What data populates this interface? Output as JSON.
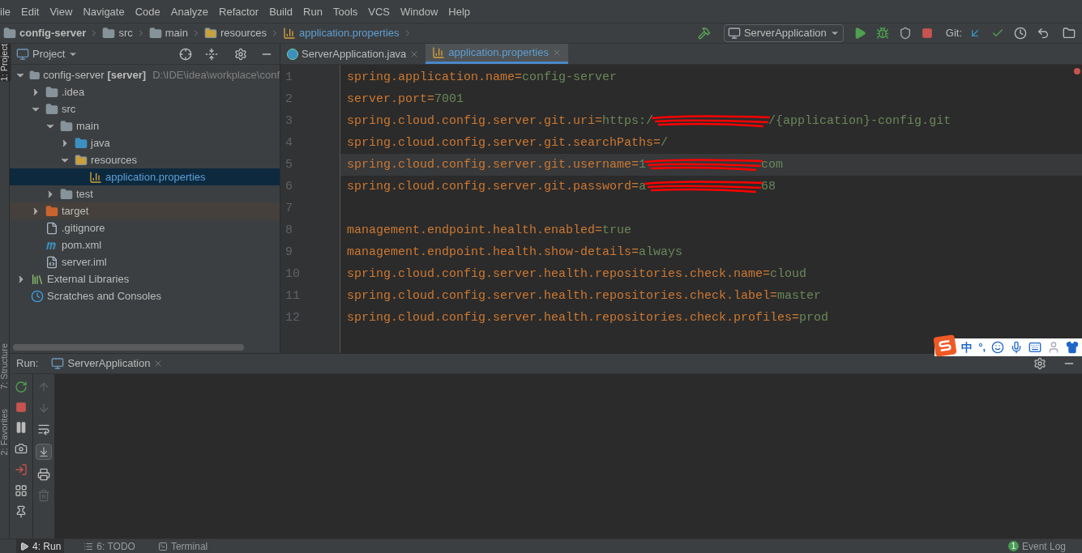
{
  "menu": [
    "ile",
    "Edit",
    "View",
    "Navigate",
    "Code",
    "Analyze",
    "Refactor",
    "Build",
    "Run",
    "Tools",
    "VCS",
    "Window",
    "Help"
  ],
  "breadcrumbs": [
    {
      "label": "config-server",
      "kind": "module"
    },
    {
      "label": "src",
      "kind": "folder"
    },
    {
      "label": "main",
      "kind": "folder"
    },
    {
      "label": "resources",
      "kind": "resources-folder"
    },
    {
      "label": "application.properties",
      "kind": "properties"
    }
  ],
  "run_config": "ServerApplication",
  "vcs_label": "Git:",
  "side_strip": [
    {
      "label": "1: Project",
      "selected": true
    },
    {
      "label": "7: Structure",
      "selected": false
    },
    {
      "label": "2: Favorites",
      "selected": false
    }
  ],
  "project_panel": {
    "title": "Project"
  },
  "tree": [
    {
      "name": "config-server",
      "module": "[server]",
      "path": "D:\\IDE\\idea\\workplace\\conf",
      "kind": "module",
      "expanded": true,
      "selected": false,
      "children": [
        {
          "name": ".idea",
          "kind": "folder",
          "expanded": false,
          "selected": false
        },
        {
          "name": "src",
          "kind": "folder",
          "expanded": true,
          "selected": false,
          "children": [
            {
              "name": "main",
              "kind": "folder",
              "expanded": true,
              "selected": false,
              "children": [
                {
                  "name": "java",
                  "kind": "source-folder",
                  "expanded": false,
                  "selected": false
                },
                {
                  "name": "resources",
                  "kind": "resources-folder",
                  "expanded": true,
                  "selected": false,
                  "children": [
                    {
                      "name": "application.properties",
                      "kind": "properties",
                      "selected": true
                    }
                  ]
                }
              ]
            },
            {
              "name": "test",
              "kind": "folder",
              "expanded": false,
              "selected": false
            }
          ]
        },
        {
          "name": "target",
          "kind": "excluded-folder",
          "expanded": false,
          "selected": false
        },
        {
          "name": ".gitignore",
          "kind": "file",
          "selected": false
        },
        {
          "name": "pom.xml",
          "kind": "maven",
          "selected": false
        },
        {
          "name": "server.iml",
          "kind": "iml",
          "selected": false
        }
      ]
    },
    {
      "name": "External Libraries",
      "kind": "libraries",
      "expanded": false,
      "selected": false
    },
    {
      "name": "Scratches and Consoles",
      "kind": "scratches",
      "selected": false
    }
  ],
  "editor_tabs": [
    {
      "label": "ServerApplication.java",
      "kind": "java",
      "selected": false
    },
    {
      "label": "application.properties",
      "kind": "properties",
      "selected": true
    }
  ],
  "lines": [
    {
      "number": "1",
      "key": "spring.application.name",
      "eq": "=",
      "value": "config-server",
      "current": false
    },
    {
      "number": "2",
      "key": "server.port",
      "eq": "=",
      "value": "7001",
      "current": false
    },
    {
      "number": "3",
      "key": "spring.cloud.config.server.git.uri",
      "eq": "=",
      "value": "https:/",
      "value_after": "/{application}-config.git",
      "current": false
    },
    {
      "number": "4",
      "key": "spring.cloud.config.server.git.searchPaths",
      "eq": "=",
      "value": "/",
      "current": false
    },
    {
      "number": "5",
      "key": "spring.cloud.config.server.git.username",
      "eq": "=",
      "value": "1",
      "value_after": "com",
      "current": true
    },
    {
      "number": "6",
      "key": "spring.cloud.config.server.git.password",
      "eq": "=",
      "value": "a",
      "value_after": "68",
      "current": false
    },
    {
      "number": "7",
      "current": false
    },
    {
      "number": "8",
      "key": "management.endpoint.health.enabled",
      "eq": "=",
      "value": "true",
      "current": false
    },
    {
      "number": "9",
      "key": "management.endpoint.health.show-details",
      "eq": "=",
      "value": "always",
      "current": false
    },
    {
      "number": "10",
      "key": "spring.cloud.config.server.health.repositories.check.name",
      "eq": "=",
      "value": "cloud",
      "current": false
    },
    {
      "number": "11",
      "key": "spring.cloud.config.server.health.repositories.check.label",
      "eq": "=",
      "value": "master",
      "current": false
    },
    {
      "number": "12",
      "key": "spring.cloud.config.server.health.repositories.check.profiles",
      "eq": "=",
      "value": "prod",
      "current": false
    }
  ],
  "ime_bar": {
    "mode": "中",
    "punctuation": "°,"
  },
  "run_panel": {
    "label": "Run:",
    "tab": "ServerApplication"
  },
  "bottom_tabs": [
    {
      "label": "4: Run",
      "kind": "run",
      "selected": true
    },
    {
      "label": "6: TODO",
      "kind": "todo",
      "selected": false
    },
    {
      "label": "Terminal",
      "kind": "terminal",
      "selected": false
    }
  ],
  "event_log": {
    "count": "1",
    "label": "Event Log"
  }
}
